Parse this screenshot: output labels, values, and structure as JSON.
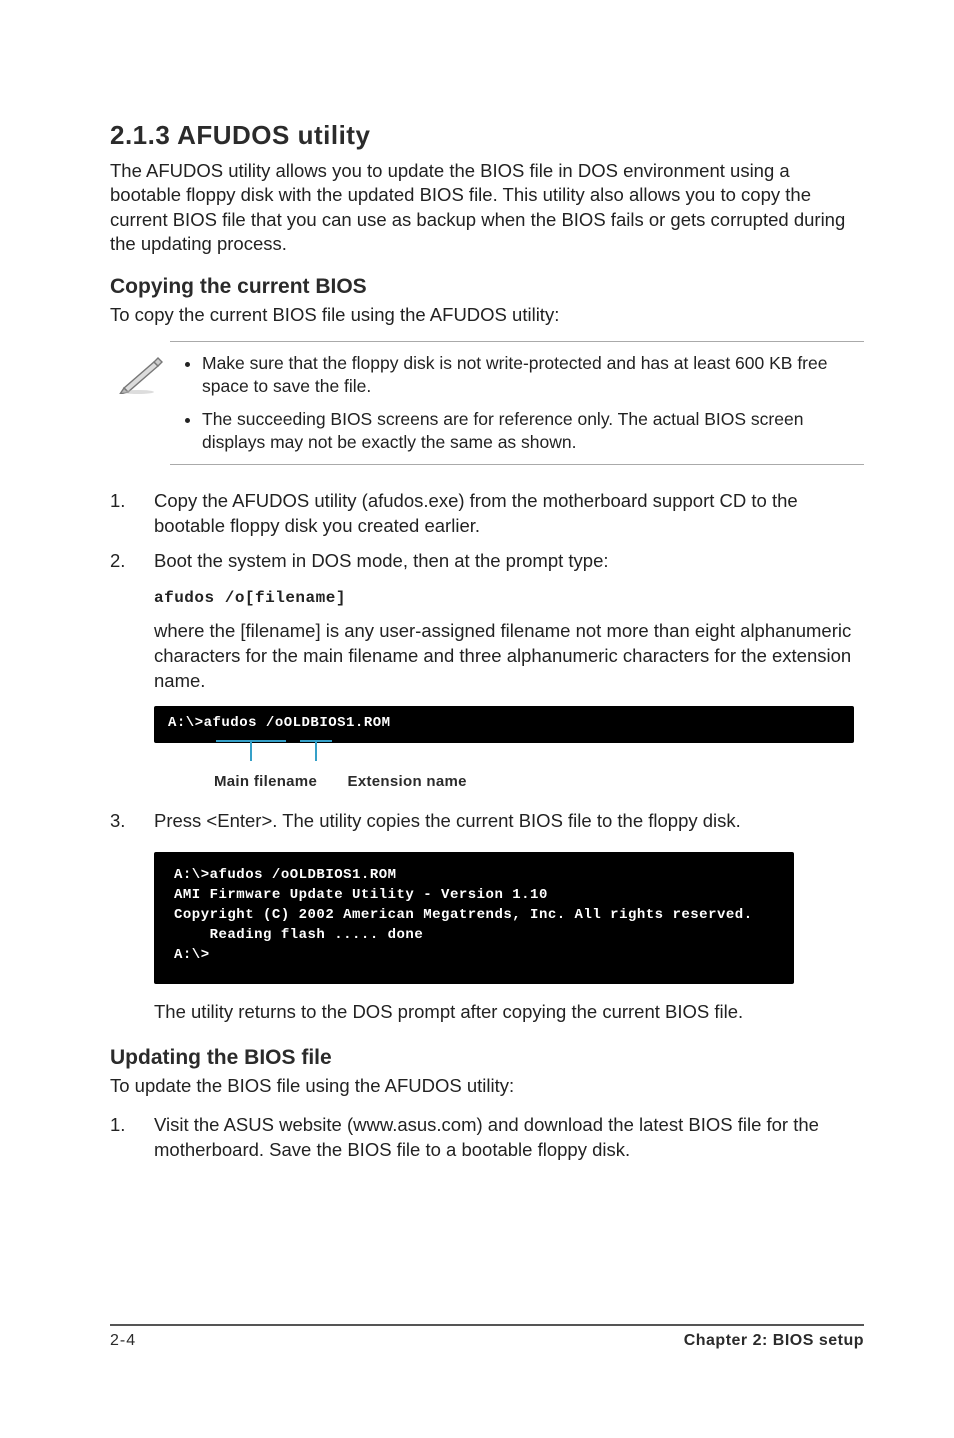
{
  "section": {
    "number_title": "2.1.3   AFUDOS utility",
    "intro": "The AFUDOS utility allows you to update the BIOS file in DOS environment using a bootable floppy disk with the updated BIOS file. This utility also allows you to copy the current BIOS file that you can use as backup when the BIOS fails or gets corrupted during the updating process."
  },
  "copy": {
    "heading": "Copying the current BIOS",
    "lead": "To copy the current BIOS file using the AFUDOS utility:",
    "notes": [
      "Make sure that the floppy disk is not write-protected and has at least 600 KB free space to save the file.",
      "The succeeding BIOS screens are for reference only. The actual BIOS screen displays may not be exactly the same as shown."
    ],
    "steps": {
      "s1": "Copy the AFUDOS utility (afudos.exe) from the motherboard support CD to the bootable floppy disk you created earlier.",
      "s2": "Boot the system in DOS mode, then at the prompt type:",
      "s2_cmd": "afudos /o[filename]",
      "s2_after": "where the [filename] is any user-assigned filename not more than eight alphanumeric characters  for the main filename and three alphanumeric characters for the extension name.",
      "annot_main": "Main filename",
      "annot_ext": "Extension name",
      "term1": "A:\\>afudos /oOLDBIOS1.ROM",
      "s3": "Press <Enter>. The utility copies the current BIOS file to the floppy disk.",
      "term2": "A:\\>afudos /oOLDBIOS1.ROM\nAMI Firmware Update Utility - Version 1.10\nCopyright (C) 2002 American Megatrends, Inc. All rights reserved.\n    Reading flash ..... done\nA:\\>",
      "s3_after": "The utility returns to the DOS prompt after copying the current BIOS file."
    }
  },
  "update": {
    "heading": "Updating the BIOS file",
    "lead": "To update the BIOS file using the AFUDOS utility:",
    "steps": {
      "s1": "Visit the ASUS website (www.asus.com) and download the latest BIOS file for the motherboard. Save the BIOS file to a bootable floppy disk."
    }
  },
  "footer": {
    "page": "2-4",
    "chapter": "Chapter 2: BIOS setup"
  }
}
